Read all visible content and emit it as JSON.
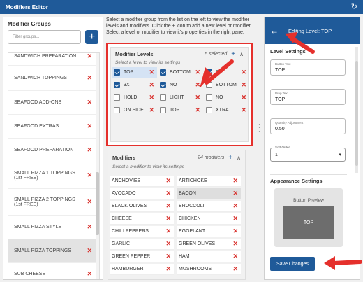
{
  "title": "Modifiers Editor",
  "left": {
    "heading": "Modifier Groups",
    "filter_placeholder": "Filter groups...",
    "add": "+",
    "groups": [
      {
        "label": "SANDWICH PREPARATION"
      },
      {
        "label": "SANDWICH TOPPINGS"
      },
      {
        "label": "SEAFOOD ADD-ONS"
      },
      {
        "label": "SEAFOOD EXTRAS"
      },
      {
        "label": "SEAFOOD PREPARATION"
      },
      {
        "label": "SMALL PIZZA 1 TOPPINGS (1st FREE)"
      },
      {
        "label": "SMALL PIZZA 2 TOPPINGS (1st FREE)"
      },
      {
        "label": "SMALL PIZZA STYLE"
      },
      {
        "label": "SMALL PIZZA TOPPINGS"
      },
      {
        "label": "SUB CHEESE"
      }
    ]
  },
  "mid": {
    "instructions": "Select a modifier group from the list on the left to view the modifier levels and modifiers. Click the + icon to add a new level or modifier. Select a level or modifier to view it's properties in the right pane.",
    "levels": {
      "title": "Modifier Levels",
      "count": "5 selected",
      "hint": "Select a level to view its settings",
      "items": [
        {
          "label": "TOP",
          "checked": true
        },
        {
          "label": "BOTTOM",
          "checked": true
        },
        {
          "label": "2X",
          "checked": true
        },
        {
          "label": "3X",
          "checked": true
        },
        {
          "label": "NO",
          "checked": true
        },
        {
          "label": "BOTTOM",
          "checked": false
        },
        {
          "label": "HOLD",
          "checked": false
        },
        {
          "label": "LIGHT",
          "checked": false
        },
        {
          "label": "NO",
          "checked": false
        },
        {
          "label": "ON SIDE",
          "checked": false
        },
        {
          "label": "TOP",
          "checked": false
        },
        {
          "label": "XTRA",
          "checked": false
        }
      ]
    },
    "modifiers": {
      "title": "Modifiers",
      "count": "24 modifiers",
      "hint": "Select a modifier to view its settings",
      "items": [
        {
          "label": "ANCHOVIES"
        },
        {
          "label": "ARTICHOKE"
        },
        {
          "label": "AVOCADO"
        },
        {
          "label": "BACON"
        },
        {
          "label": "BLACK OLIVES"
        },
        {
          "label": "BROCCOLI"
        },
        {
          "label": "CHEESE"
        },
        {
          "label": "CHICKEN"
        },
        {
          "label": "CHILI PEPPERS"
        },
        {
          "label": "EGGPLANT"
        },
        {
          "label": "GARLIC"
        },
        {
          "label": "GREEN OLIVES"
        },
        {
          "label": "GREEN PEPPER"
        },
        {
          "label": "HAM"
        },
        {
          "label": "HAMBURGER"
        },
        {
          "label": "MUSHROOMS"
        }
      ]
    }
  },
  "right": {
    "header": "Editing Level: TOP",
    "section_title": "Level Settings",
    "button_text_label": "Button Text",
    "button_text": "TOP",
    "prep_text_label": "Prep Text",
    "prep_text": "TOP",
    "qty_label": "Quantity Adjustment",
    "qty": "0.50",
    "sort_label": "Sort Order",
    "sort_value": "1",
    "appearance": "Appearance Settings",
    "preview_label": "Button Preview",
    "preview_button": "TOP",
    "save": "Save Changes"
  },
  "colors": {
    "accent": "#1f5a99",
    "highlight": "#e5302c",
    "delete": "#d9302c"
  }
}
